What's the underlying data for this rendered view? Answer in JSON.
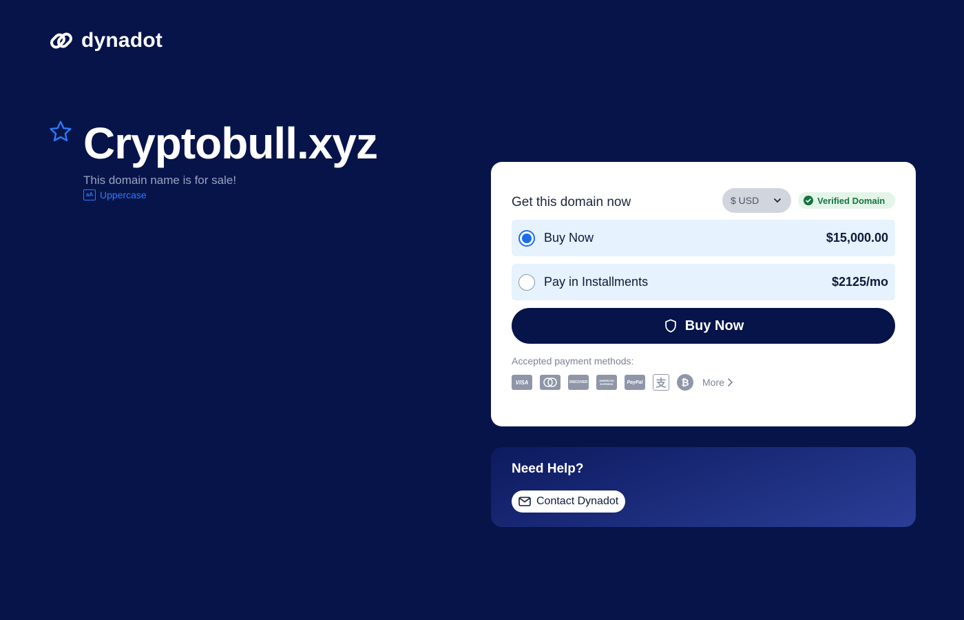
{
  "brand": {
    "name": "dynadot"
  },
  "domain": {
    "name": "Cryptobull.xyz",
    "subtitle": "This domain name is for sale!",
    "uppercase_label": "Uppercase",
    "uppercase_icon_text": "aA"
  },
  "purchase": {
    "title": "Get this domain now",
    "currency": "$ USD",
    "verified_label": "Verified Domain",
    "options": [
      {
        "label": "Buy Now",
        "price": "$15,000.00",
        "selected": true
      },
      {
        "label": "Pay in Installments",
        "price": "$2125/mo",
        "selected": false
      }
    ],
    "buy_button": "Buy Now",
    "payment_label": "Accepted payment methods:",
    "payment_methods": [
      {
        "name": "visa-icon",
        "text": "VISA"
      },
      {
        "name": "mastercard-icon",
        "text": ""
      },
      {
        "name": "discover-icon",
        "text": "DISCOVER"
      },
      {
        "name": "amex-icon",
        "text": "AMERICAN EXPRESS"
      },
      {
        "name": "paypal-icon",
        "text": "PayPal"
      },
      {
        "name": "alipay-icon",
        "text": "支"
      },
      {
        "name": "bitcoin-icon",
        "text": "₿"
      }
    ],
    "more_label": "More"
  },
  "help": {
    "title": "Need Help?",
    "contact_label": "Contact Dynadot"
  },
  "colors": {
    "background": "#07144a",
    "accent": "#1a6cf0",
    "option_bg": "#e6f2fd",
    "verified_green": "#16733f"
  }
}
